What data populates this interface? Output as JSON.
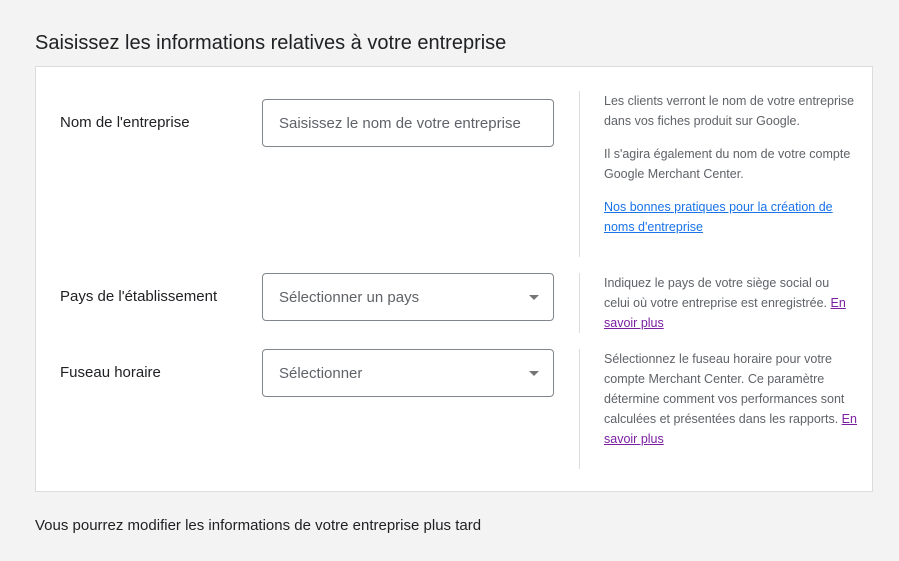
{
  "page": {
    "title": "Saisissez les informations relatives à votre entreprise",
    "footer_note": "Vous pourrez modifier les informations de votre entreprise plus tard"
  },
  "form": {
    "business_name": {
      "label": "Nom de l'entreprise",
      "placeholder": "Saisissez le nom de votre entreprise",
      "value": "",
      "help_1": "Les clients verront le nom de votre entreprise dans vos fiches produit sur Google.",
      "help_2": "Il s'agira également du nom de votre compte Google Merchant Center.",
      "help_link": "Nos bonnes pratiques pour la création de noms d'entreprise"
    },
    "country": {
      "label": "Pays de l'établissement",
      "selected": "Sélectionner un pays",
      "help": "Indiquez le pays de votre siège social ou celui où votre entreprise est enregistrée.",
      "help_link": "En savoir plus"
    },
    "timezone": {
      "label": "Fuseau horaire",
      "selected": "Sélectionner",
      "help": "Sélectionnez le fuseau horaire pour votre compte Merchant Center. Ce paramètre détermine comment vos performances sont calculées et présentées dans les rapports.",
      "help_link": "En savoir plus"
    }
  },
  "colors": {
    "link": "#1a73e8",
    "visited_link": "#7b1fa2",
    "border": "#dadce0",
    "text": "#202124",
    "secondary_text": "#5f6368"
  },
  "icons": {
    "dropdown": "caret-down-icon"
  }
}
